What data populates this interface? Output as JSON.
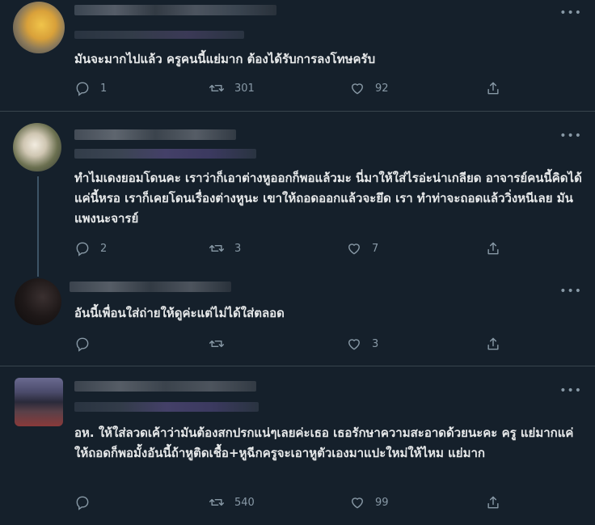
{
  "tweets": [
    {
      "text": "มันจะมากไปแล้ว ครูคนนี้แย่มาก ต้องได้รับการลงโทษครับ",
      "reply_count": "1",
      "retweet_count": "301",
      "like_count": "92"
    },
    {
      "text": "ทำไมเดงยอมโดนคะ เราว่าก็เอาต่างหูออกก็พอแล้วมะ นี่มาให้ใส่ไรอ่ะน่าเกลียด อาจารย์คนนี้คิดได้แค่นี้หรอ เราก็เคยโดนเรื่องต่างหูนะ เขาให้ถอดออกแล้วจะยึด เรา ทำท่าจะถอดแล้ววิ่งหนีเลย มันแพงนะจารย์",
      "reply_count": "2",
      "retweet_count": "3",
      "like_count": "7"
    },
    {
      "text": "อันนี้เพื่อนใส่ถ่ายให้ดูค่ะแต่ไม่ได้ใส่ตลอด",
      "reply_count": "",
      "retweet_count": "",
      "like_count": "3"
    },
    {
      "text": "อห. ให้ใส่ลวดเค้าว่ามันต้องสกปรกแน่ๆเลยค่ะเธอ เธอรักษาความสะอาดด้วยนะคะ ครู แย่มากแค่ให้ถอดก็พอมั้งอันนี้ถ้าหูติดเชื้อ+หูฉีกครูจะเอาหูตัวเองมาแปะใหม่ให้ไหม แย่มาก",
      "reply_count": "",
      "retweet_count": "540",
      "like_count": "99"
    }
  ],
  "colors": {
    "background": "#15202b",
    "text": "#e7e9ea",
    "muted": "#8899a6",
    "divider": "#38444d"
  },
  "icons": [
    "reply-icon",
    "retweet-icon",
    "like-icon",
    "share-icon",
    "more-icon"
  ]
}
